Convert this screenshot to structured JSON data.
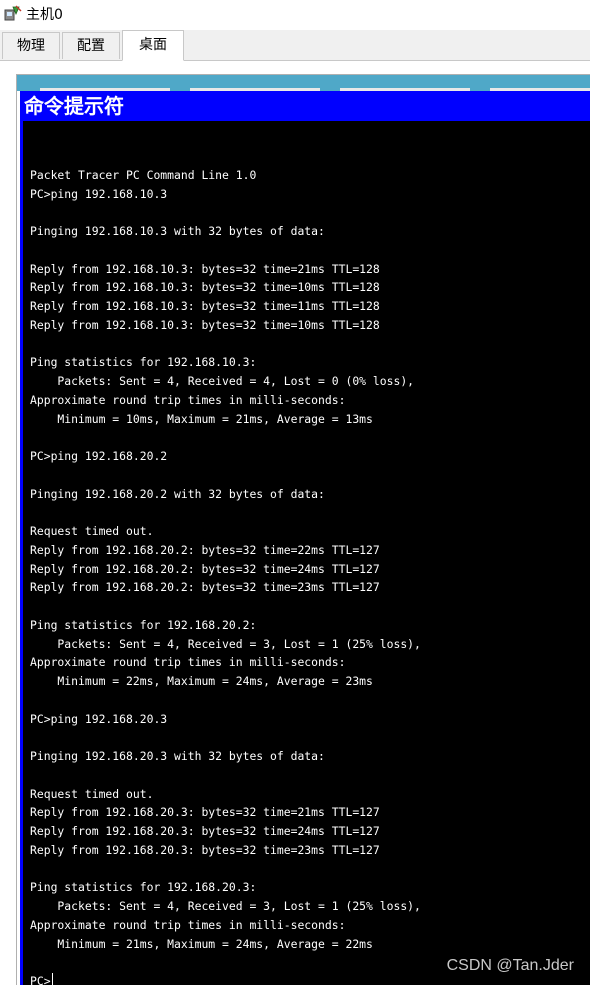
{
  "window": {
    "title": "主机0",
    "icon": "packet-tracer-host-icon"
  },
  "tabs": [
    {
      "label": "物理",
      "active": false
    },
    {
      "label": "配置",
      "active": false
    },
    {
      "label": "桌面",
      "active": true
    }
  ],
  "cmd": {
    "title": "命令提示符",
    "lines": [
      "",
      "Packet Tracer PC Command Line 1.0",
      "PC>ping 192.168.10.3",
      "",
      "Pinging 192.168.10.3 with 32 bytes of data:",
      "",
      "Reply from 192.168.10.3: bytes=32 time=21ms TTL=128",
      "Reply from 192.168.10.3: bytes=32 time=10ms TTL=128",
      "Reply from 192.168.10.3: bytes=32 time=11ms TTL=128",
      "Reply from 192.168.10.3: bytes=32 time=10ms TTL=128",
      "",
      "Ping statistics for 192.168.10.3:",
      "    Packets: Sent = 4, Received = 4, Lost = 0 (0% loss),",
      "Approximate round trip times in milli-seconds:",
      "    Minimum = 10ms, Maximum = 21ms, Average = 13ms",
      "",
      "PC>ping 192.168.20.2",
      "",
      "Pinging 192.168.20.2 with 32 bytes of data:",
      "",
      "Request timed out.",
      "Reply from 192.168.20.2: bytes=32 time=22ms TTL=127",
      "Reply from 192.168.20.2: bytes=32 time=24ms TTL=127",
      "Reply from 192.168.20.2: bytes=32 time=23ms TTL=127",
      "",
      "Ping statistics for 192.168.20.2:",
      "    Packets: Sent = 4, Received = 3, Lost = 1 (25% loss),",
      "Approximate round trip times in milli-seconds:",
      "    Minimum = 22ms, Maximum = 24ms, Average = 23ms",
      "",
      "PC>ping 192.168.20.3",
      "",
      "Pinging 192.168.20.3 with 32 bytes of data:",
      "",
      "Request timed out.",
      "Reply from 192.168.20.3: bytes=32 time=21ms TTL=127",
      "Reply from 192.168.20.3: bytes=32 time=24ms TTL=127",
      "Reply from 192.168.20.3: bytes=32 time=23ms TTL=127",
      "",
      "Ping statistics for 192.168.20.3:",
      "    Packets: Sent = 4, Received = 3, Lost = 1 (25% loss),",
      "Approximate round trip times in milli-seconds:",
      "    Minimum = 21ms, Maximum = 24ms, Average = 22ms",
      ""
    ],
    "prompt": "PC>"
  },
  "watermark": "CSDN @Tan.Jder",
  "colors": {
    "cmd_title_bg": "#0000ff",
    "cmd_body_bg": "#000000",
    "cmd_text": "#ffffff"
  }
}
